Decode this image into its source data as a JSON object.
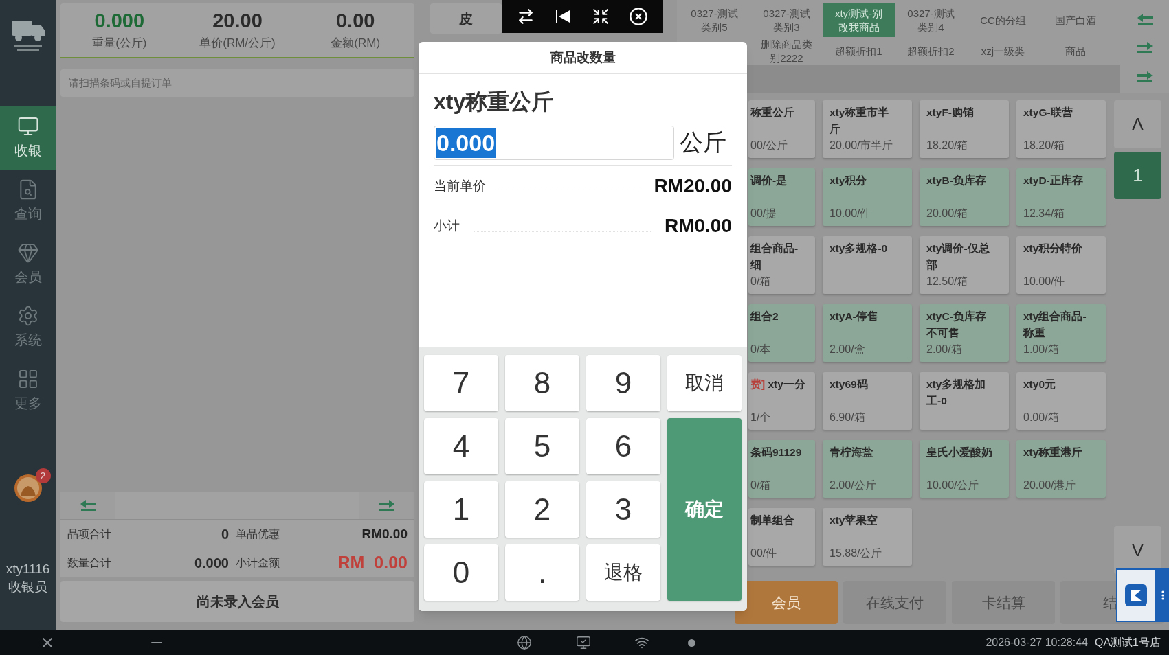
{
  "sidebar": {
    "items": [
      {
        "label": "收银",
        "selected": true
      },
      {
        "label": "查询",
        "selected": false
      },
      {
        "label": "会员",
        "selected": false
      },
      {
        "label": "系统",
        "selected": false
      },
      {
        "label": "更多",
        "selected": false
      }
    ],
    "badge": "2",
    "user": "xty1116",
    "role": "收银员"
  },
  "stats": [
    {
      "value": "0.000",
      "label": "重量(公斤)",
      "highlight": true
    },
    {
      "value": "20.00",
      "label": "单价(RM/公斤)",
      "highlight": false
    },
    {
      "value": "0.00",
      "label": "金额(RM)",
      "highlight": false
    }
  ],
  "tare_button": "皮",
  "scan": {
    "placeholder": "请扫描条码或自提订单"
  },
  "summary": [
    {
      "label": "品项合计",
      "value": "0",
      "label2": "单品优惠",
      "value2": "RM0.00",
      "emphasis": false
    },
    {
      "label": "数量合计",
      "value": "0.000",
      "label2": "小计金额",
      "value2": "RM  0.00",
      "emphasis": true
    }
  ],
  "member_button": "尚未录入会员",
  "category_rows": [
    [
      {
        "label": "0327-测试类别5",
        "selected": false
      },
      {
        "label": "0327-测试类别3",
        "selected": false
      },
      {
        "label": "xty测试-别改我商品",
        "selected": true
      },
      {
        "label": "0327-测试类别4",
        "selected": false
      },
      {
        "label": "CC的分组",
        "selected": false
      },
      {
        "label": "国产白酒",
        "selected": false
      }
    ],
    [
      {
        "label": "删除商品类别2222",
        "selected": false
      },
      {
        "label": "超额折扣1",
        "selected": false
      },
      {
        "label": "超额折扣2",
        "selected": false
      },
      {
        "label": "xzj一级类",
        "selected": false
      },
      {
        "label": "商品",
        "selected": false
      }
    ]
  ],
  "products": [
    {
      "name": "称重公斤",
      "price": "00/公斤",
      "color": "#a8a8a8"
    },
    {
      "name": "xty称重市半斤",
      "price": "20.00/市半斤",
      "color": "#a8a8a8"
    },
    {
      "name": "xtyF-购销",
      "price": "18.20/箱",
      "color": "#a8a8a8"
    },
    {
      "name": "xtyG-联营",
      "price": "18.20/箱",
      "color": "#a8a8a8"
    },
    {
      "name": "调价-是",
      "price": "00/提",
      "color": "#8ca797"
    },
    {
      "name": "xty积分",
      "price": "10.00/件",
      "color": "#8ca797"
    },
    {
      "name": "xtyB-负库存",
      "price": "20.00/箱",
      "color": "#8ca797"
    },
    {
      "name": "xtyD-正库存",
      "price": "12.34/箱",
      "color": "#8ca797"
    },
    {
      "name": "组合商品-细",
      "price": "0/箱",
      "color": "#a8a8a8"
    },
    {
      "name": "xty多规格-0",
      "color": "#a8a8a8"
    },
    {
      "name": "xty调价-仅总部",
      "price": "12.50/箱",
      "color": "#a8a8a8"
    },
    {
      "name": "xty积分特价",
      "price": "10.00/件",
      "color": "#a8a8a8"
    },
    {
      "name": "组合2",
      "price": "0/本",
      "color": "#8ca797"
    },
    {
      "name": "xtyA-停售",
      "price": "2.00/盒",
      "color": "#8ca797"
    },
    {
      "name": "xtyC-负库存不可售",
      "price": "2.00/箱",
      "color": "#8ca797"
    },
    {
      "name": "xty组合商品-称重",
      "price": "1.00/箱",
      "color": "#8ca797"
    },
    {
      "tag": "费]",
      "name": "xty一分",
      "price": "1/个",
      "color": "#a8a8a8"
    },
    {
      "name": "xty69码",
      "price": "6.90/箱",
      "color": "#a8a8a8"
    },
    {
      "name": "xty多规格加工-0",
      "color": "#a8a8a8"
    },
    {
      "name": "xty0元",
      "price": "0.00/箱",
      "color": "#a8a8a8"
    },
    {
      "name": "条码91129",
      "price": "0/箱",
      "color": "#8ca797"
    },
    {
      "name": "青柠海盐",
      "price": "2.00/公斤",
      "color": "#8ca797"
    },
    {
      "name": "皇氏小爱酸奶",
      "price": "10.00/公斤",
      "color": "#8ca797"
    },
    {
      "name": "xty称重港斤",
      "price": "20.00/港斤",
      "color": "#8ca797"
    },
    {
      "name": "制单组合",
      "price": "00/件",
      "color": "#a8a8a8"
    },
    {
      "name": "xty苹果空",
      "price": "15.88/公斤",
      "color": "#a8a8a8"
    }
  ],
  "pager": {
    "up": "Λ",
    "page": "1",
    "down": "V"
  },
  "actions": [
    {
      "label": "会员",
      "kind": "primary"
    },
    {
      "label": "在线支付",
      "kind": "default"
    },
    {
      "label": "卡结算",
      "kind": "default"
    },
    {
      "label": "结",
      "kind": "default"
    }
  ],
  "dialog": {
    "title": "商品改数量",
    "product": "xty称重公斤",
    "quantity": "0.000",
    "quantity_selected": true,
    "unit": "公斤",
    "rows": [
      {
        "label": "当前单价",
        "value": "RM20.00"
      },
      {
        "label": "小计",
        "value": "RM0.00"
      }
    ],
    "keys": [
      {
        "label": "7",
        "kind": "digit"
      },
      {
        "label": "8",
        "kind": "digit"
      },
      {
        "label": "9",
        "kind": "digit"
      },
      {
        "label": "取消",
        "kind": "action"
      },
      {
        "label": "4",
        "kind": "digit"
      },
      {
        "label": "5",
        "kind": "digit"
      },
      {
        "label": "6",
        "kind": "digit"
      },
      {
        "label": "1",
        "kind": "digit"
      },
      {
        "label": "2",
        "kind": "digit"
      },
      {
        "label": "3",
        "kind": "digit"
      },
      {
        "label": "确定",
        "kind": "confirm"
      },
      {
        "label": "0",
        "kind": "digit"
      },
      {
        "label": ".",
        "kind": "digit"
      },
      {
        "label": "退格",
        "kind": "action"
      }
    ]
  },
  "taskbar": {
    "datetime": "2026-03-27 10:28:44",
    "store": "QA测试1号店"
  }
}
